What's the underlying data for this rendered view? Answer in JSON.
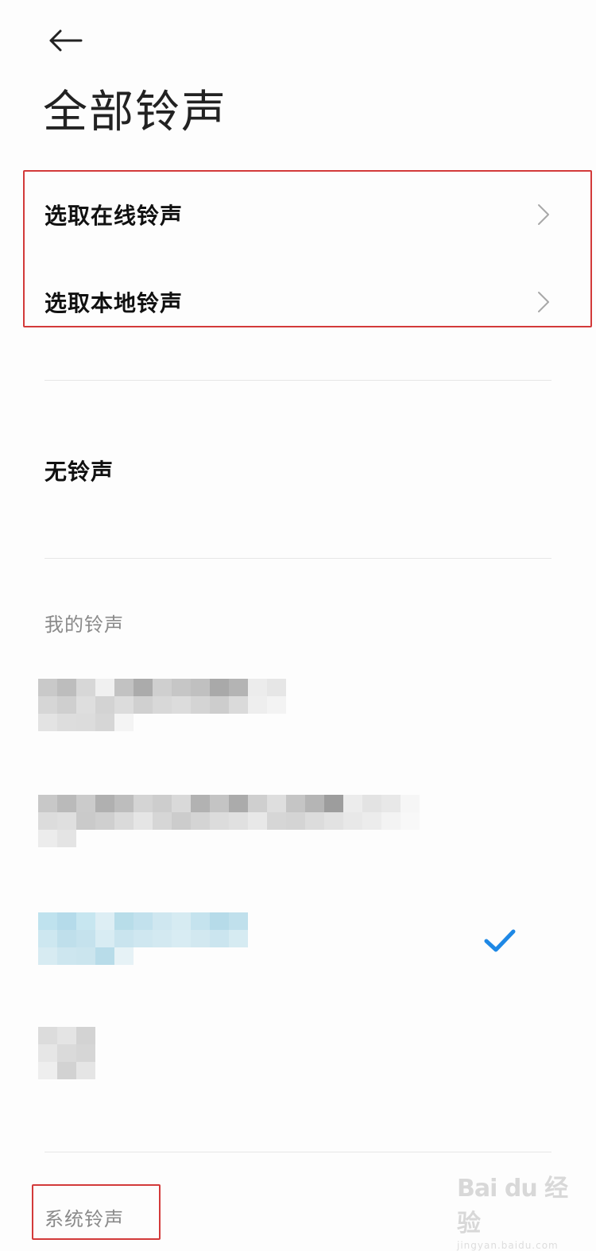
{
  "header": {
    "back_icon": "arrow-left-icon",
    "title": "全部铃声"
  },
  "options": [
    {
      "label": "选取在线铃声",
      "icon": "chevron-right-icon"
    },
    {
      "label": "选取本地铃声",
      "icon": "chevron-right-icon"
    }
  ],
  "no_ringtone": {
    "label": "无铃声"
  },
  "my_ringtones": {
    "section_label": "我的铃声",
    "selected_index": 2,
    "check_icon": "checkmark-icon"
  },
  "system_ringtones": {
    "section_label": "系统铃声"
  },
  "watermark": {
    "logo": "Bai du 经验",
    "url": "jingyan.baidu.com"
  },
  "colors": {
    "accent": "#1e88e5",
    "highlight_border": "#d33a3a",
    "divider": "#e6e6e6",
    "secondary_text": "#8a8a8a"
  }
}
